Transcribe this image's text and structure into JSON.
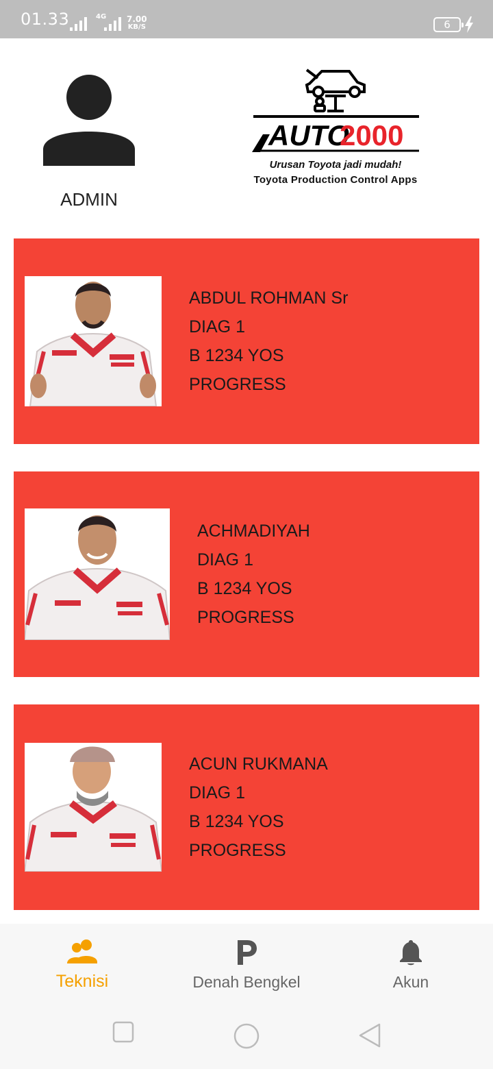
{
  "status_bar": {
    "time": "01.33",
    "network": "4G",
    "speed_value": "7.00",
    "speed_unit": "KB/S",
    "battery": "6"
  },
  "header": {
    "user_label": "ADMIN",
    "logo_text": "AUTO",
    "logo_number": "2000",
    "tagline": "Urusan Toyota jadi mudah!",
    "subtitle": "Toyota Production Control Apps"
  },
  "technicians": [
    {
      "name": "ABDUL ROHMAN Sr",
      "role": "DIAG 1",
      "plate": "B 1234 YOS",
      "status": "PROGRESS"
    },
    {
      "name": "ACHMADIYAH",
      "role": "DIAG 1",
      "plate": "B 1234 YOS",
      "status": "PROGRESS"
    },
    {
      "name": "ACUN RUKMANA",
      "role": "DIAG 1",
      "plate": "B 1234 YOS",
      "status": "PROGRESS"
    }
  ],
  "bottom_nav": {
    "items": [
      {
        "label": "Teknisi",
        "icon": "people-icon",
        "active": true
      },
      {
        "label": "Denah Bengkel",
        "icon": "parking-icon",
        "active": false
      },
      {
        "label": "Akun",
        "icon": "bell-icon",
        "active": false
      }
    ]
  },
  "colors": {
    "card": "#f44336",
    "accent": "#f5a000",
    "status_bar": "#bdbdbd",
    "logo_red": "#e8242b"
  }
}
